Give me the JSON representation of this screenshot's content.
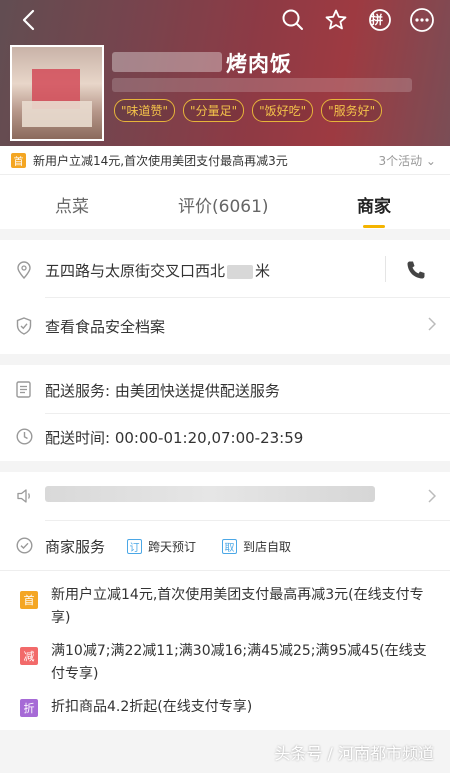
{
  "header": {
    "title": "烤肉饭",
    "tags": [
      "\"味道赞\"",
      "\"分量足\"",
      "\"饭好吃\"",
      "\"服务好\""
    ],
    "pin_label": "拼"
  },
  "promo": {
    "badge": "首",
    "text": "新用户立减14元,首次使用美团支付最高再减3元",
    "count": "3个活动 ⌄"
  },
  "tabs": [
    {
      "label": "点菜"
    },
    {
      "label": "评价(6061)"
    },
    {
      "label": "商家"
    }
  ],
  "info": {
    "address_prefix": "五四路与太原街交叉口西北",
    "address_suffix": "米",
    "food_safety": "查看食品安全档案",
    "delivery_service": "配送服务: 由美团快送提供配送服务",
    "delivery_time": "配送时间:  00:00-01:20,07:00-23:59"
  },
  "services": {
    "label": "商家服务",
    "items": [
      {
        "badge": "订",
        "label": "跨天预订"
      },
      {
        "badge": "取",
        "label": "到店自取"
      }
    ]
  },
  "activities": [
    {
      "badge": "首",
      "color": "#f4a623",
      "text": "新用户立减14元,首次使用美团支付最高再减3元(在线支付专享)"
    },
    {
      "badge": "减",
      "color": "#f26a6a",
      "text": "满10减7;满22减11;满30减16;满45减25;满95减45(在线支付专享)"
    },
    {
      "badge": "折",
      "color": "#a66ad6",
      "text": "折扣商品4.2折起(在线支付专享)"
    }
  ],
  "watermark": "头条号 / 河南都市频道"
}
